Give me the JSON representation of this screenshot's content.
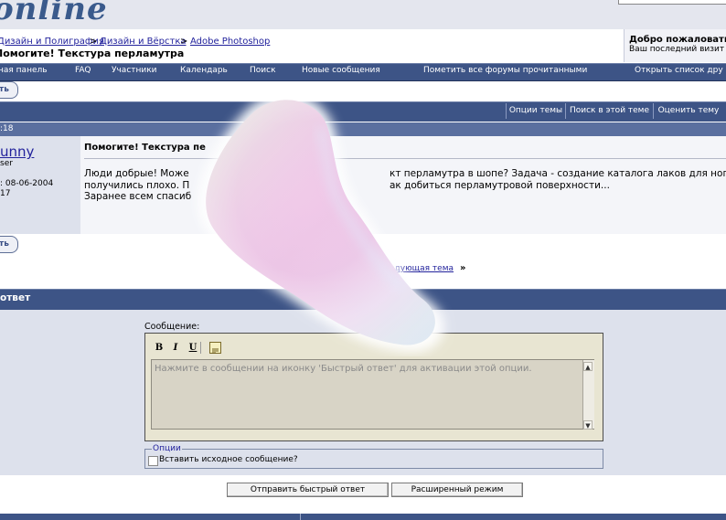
{
  "header": {
    "logo_text": "online",
    "breadcrumbs": [
      "Дизайн и Полиграфия",
      "Дизайн и Вёрстка",
      "Adobe Photoshop"
    ],
    "breadcrumb_sep": ">",
    "thread_title": "Помогите! Текстура перламутра",
    "welcome": "Добро пожаловать,",
    "last_visit": "Ваш последний визит"
  },
  "nav": {
    "items": [
      "Панель",
      "FAQ",
      "Участники",
      "Календарь",
      "Поиск",
      "Новые сообщения",
      "Пометить все форумы прочитанными",
      "Открыть список друзей"
    ],
    "display": [
      "ная панель",
      "FAQ",
      "Участники",
      "Календарь",
      "Поиск",
      "Новые сообщения",
      "Пометить все форумы прочитанными",
      "Открыть список дру"
    ]
  },
  "reply_button": "ть",
  "thread_tools": [
    "Опции темы",
    "Поиск в этой теме",
    "Оценить тему"
  ],
  "post": {
    "time": ":18",
    "username": "unny",
    "user_title": "ser",
    "reg_date": ": 08-06-2004",
    "post_count": "17",
    "title": "Помогите! Текстура пе",
    "line1_a": "Люди добрые! Може",
    "line1_b": "кт перламутра в шопе? Задача - создание каталога лаков для ногтей",
    "line2_a": "получились плохо. П",
    "line2_b": "ак добиться перламутровой поверхности...",
    "line3": "Заранее всем спасиб"
  },
  "next_thread": "едующая тема",
  "next_arrow": "»",
  "quick_reply": {
    "title": "ответ",
    "message_label": "Сообщение:",
    "format_bold": "B",
    "format_italic": "I",
    "format_underline": "U",
    "placeholder": "Нажмите в сообщении на иконку 'Быстрый ответ'  для активации этой опции.",
    "options_legend": "Опции",
    "quote_label": "Вставить исходное сообщение?",
    "submit_label": "Отправить быстрый ответ",
    "advanced_label": "Расширенный режим"
  },
  "colors": {
    "nav_bg": "#3d5486",
    "panel_bg": "#dde1ec",
    "link": "#22229c",
    "editor_bg": "#e8e5d2"
  }
}
